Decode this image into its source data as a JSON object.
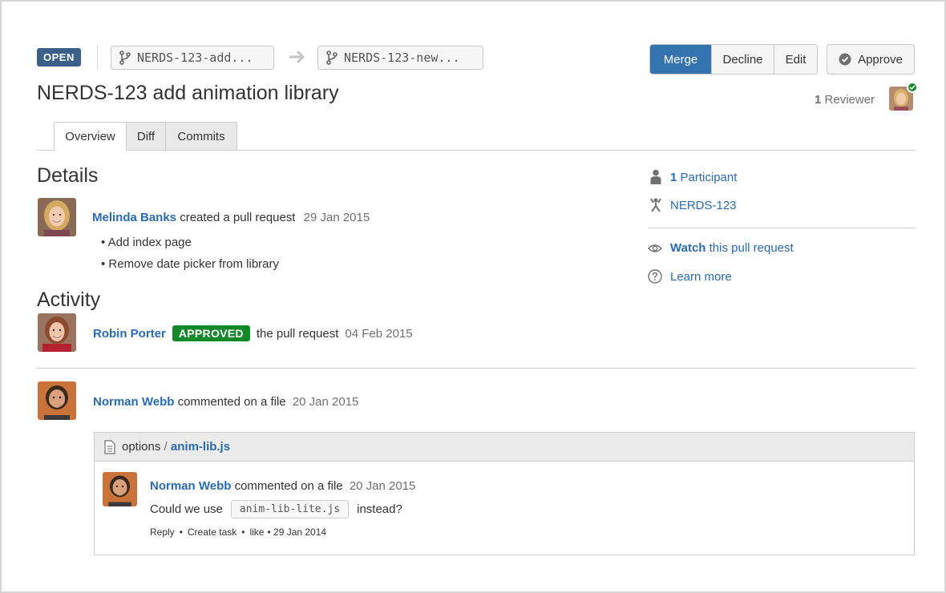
{
  "header": {
    "status": "OPEN",
    "source_branch": "NERDS-123-add...",
    "target_branch": "NERDS-123-new...",
    "title": "NERDS-123 add animation library",
    "buttons": {
      "merge": "Merge",
      "decline": "Decline",
      "edit": "Edit",
      "approve": "Approve"
    },
    "reviewer_count": "1",
    "reviewer_label": "Reviewer"
  },
  "tabs": [
    {
      "label": "Overview",
      "active": true
    },
    {
      "label": "Diff",
      "active": false
    },
    {
      "label": "Commits",
      "active": false
    }
  ],
  "details": {
    "heading": "Details",
    "author": "Melinda Banks",
    "action": "created a pull request",
    "date": "29 Jan 2015",
    "bullets": [
      "• Add index page",
      "• Remove date picker from library"
    ]
  },
  "activity": {
    "heading": "Activity",
    "approval": {
      "author": "Robin Porter",
      "badge": "APPROVED",
      "text": "the pull request",
      "date": "04 Feb 2015"
    },
    "file_comment": {
      "author": "Norman Webb",
      "action": "commented on a file",
      "date": "20 Jan 2015",
      "file_dir": "options",
      "file_sep": "/",
      "file_name": "anim-lib.js",
      "comment": {
        "author": "Norman Webb",
        "action": "commented on a file",
        "date": "20 Jan 2015",
        "text_before": "Could we use",
        "code": "anim-lib-lite.js",
        "text_after": "instead?",
        "actions": {
          "reply": "Reply",
          "create_task": "Create task",
          "like": "like",
          "date": "29 Jan 2014",
          "bullet": "•"
        }
      }
    }
  },
  "sidebar": {
    "participants_count": "1",
    "participants_label": "Participant",
    "issue_key": "NERDS-123",
    "watch_bold": "Watch",
    "watch_rest": "this pull request",
    "learn_more": "Learn more"
  },
  "icons": {
    "branch": "branch-icon",
    "arrow": "arrow-right-icon",
    "approve": "check-circle-icon",
    "file": "file-icon",
    "person": "person-icon",
    "jira": "jira-icon",
    "eye": "eye-icon",
    "help": "question-circle-icon"
  },
  "colors": {
    "primary": "#3572b0",
    "link": "#2a6bb0",
    "open_lozenge": "#3b6089",
    "approved": "#14892c"
  }
}
